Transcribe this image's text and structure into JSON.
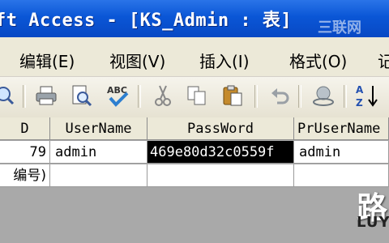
{
  "window": {
    "title": "ft Access - [KS_Admin : 表]"
  },
  "watermark": {
    "top": "三联网",
    "logo_big": "路",
    "logo_small": "LUY"
  },
  "menu": [
    "编辑(E)",
    "视图(V)",
    "插入(I)",
    "格式(O)",
    "记"
  ],
  "toolbar": {
    "icons": [
      "preview-icon",
      "print-icon",
      "print-preview-icon",
      "spelling-icon",
      "cut-icon",
      "copy-icon",
      "paste-icon",
      "undo-icon",
      "hyperlink-icon",
      "sort-ascending-icon"
    ]
  },
  "table": {
    "columns": [
      "D",
      "UserName",
      "PassWord",
      "PrUserName"
    ],
    "rows": [
      [
        "79",
        "admin",
        "469e80d32c0559f",
        "admin"
      ],
      [
        "编号)",
        "",
        "",
        ""
      ]
    ],
    "selected_cell": {
      "row": 0,
      "column": "PassWord"
    }
  },
  "colors": {
    "title_blue": "#0a56d6",
    "menu_bg": "#ece9d8",
    "selection": "#000000",
    "empty_area": "#a9a9a9"
  }
}
